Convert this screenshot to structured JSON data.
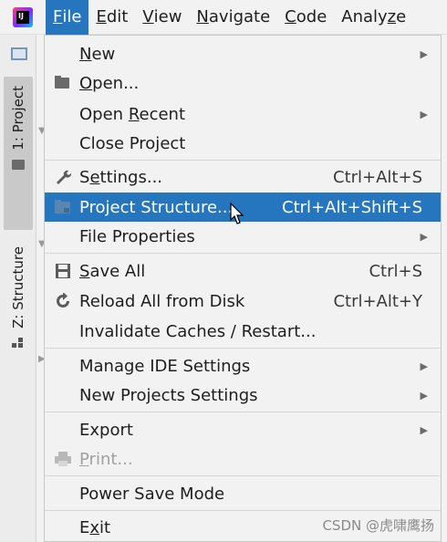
{
  "menubar": {
    "app_icon_text": "IJ",
    "items": [
      "File",
      "Edit",
      "View",
      "Navigate",
      "Code",
      "Analyze"
    ],
    "active": "File"
  },
  "toolstrip": {
    "project_tab": "1: Project",
    "structure_tab": "Z: Structure"
  },
  "file_menu": {
    "new": "New",
    "open": "Open...",
    "open_recent": "Open Recent",
    "close_project": "Close Project",
    "settings": "Settings...",
    "settings_shortcut": "Ctrl+Alt+S",
    "project_structure": "Project Structure...",
    "project_structure_shortcut": "Ctrl+Alt+Shift+S",
    "file_properties": "File Properties",
    "save_all": "Save All",
    "save_all_shortcut": "Ctrl+S",
    "reload": "Reload All from Disk",
    "reload_shortcut": "Ctrl+Alt+Y",
    "invalidate": "Invalidate Caches / Restart...",
    "manage_ide": "Manage IDE Settings",
    "new_projects_settings": "New Projects Settings",
    "export": "Export",
    "print": "Print...",
    "power_save": "Power Save Mode",
    "exit": "Exit"
  },
  "watermark": "CSDN @虎啸鹰扬",
  "colors": {
    "selection": "#2675bf",
    "background": "#f2f2f2",
    "disabled": "#a0a0a0"
  }
}
